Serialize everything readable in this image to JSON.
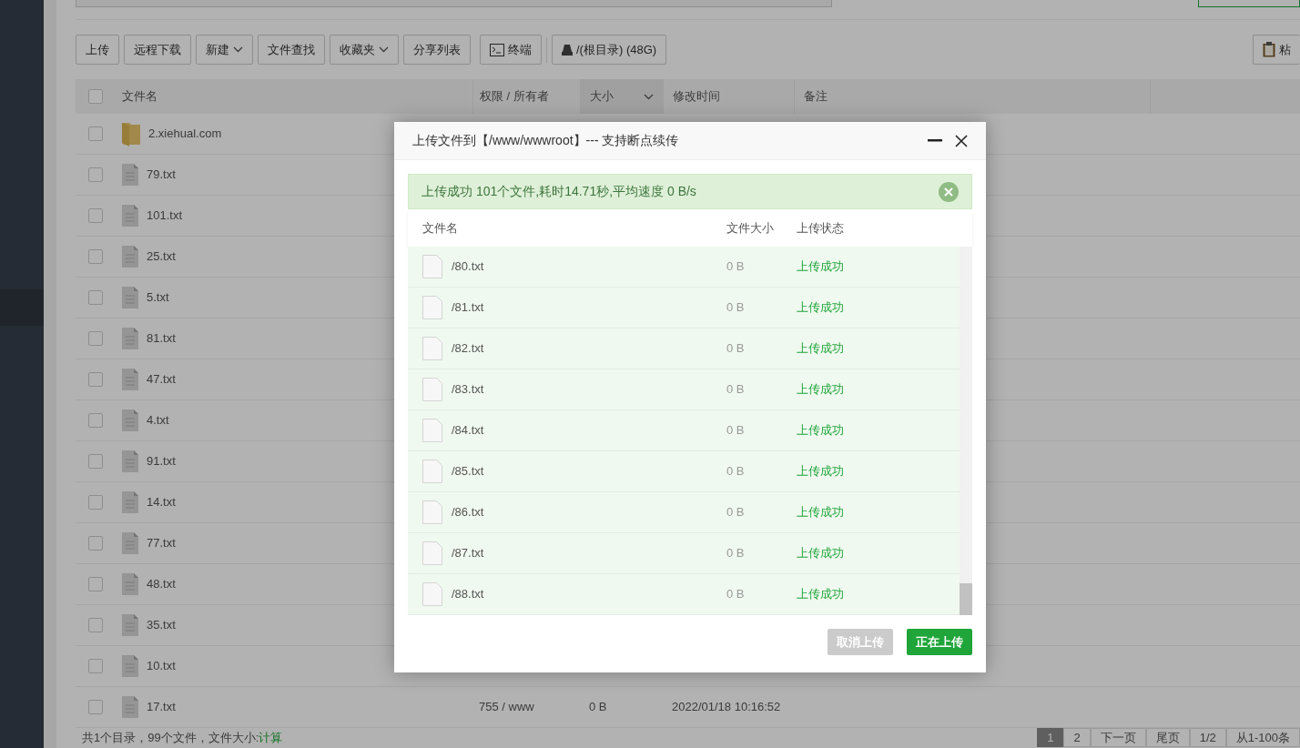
{
  "toolbar": {
    "buttons": [
      {
        "label": "上传",
        "kind": "plain"
      },
      {
        "label": "远程下载",
        "kind": "plain"
      },
      {
        "label": "新建",
        "kind": "dropdown"
      },
      {
        "label": "文件查找",
        "kind": "plain"
      },
      {
        "label": "收藏夹",
        "kind": "dropdown"
      },
      {
        "label": "分享列表",
        "kind": "plain"
      },
      {
        "label": "终端",
        "kind": "terminal"
      },
      {
        "label": "/(根目录) (48G)",
        "kind": "disk"
      }
    ],
    "paste_button": {
      "label": "粘"
    }
  },
  "file_table": {
    "all_checked": false,
    "columns": [
      {
        "label": "文件名",
        "sorted": false
      },
      {
        "label": "权限 / 所有者",
        "sorted": false
      },
      {
        "label": "大小",
        "sorted": true
      },
      {
        "label": "修改时间",
        "sorted": false
      },
      {
        "label": "备注",
        "sorted": false
      }
    ],
    "rows": [
      {
        "name": "2.xiehual.com",
        "kind": "folder",
        "checked": false
      },
      {
        "name": "79.txt",
        "kind": "file",
        "checked": false
      },
      {
        "name": "101.txt",
        "kind": "file",
        "checked": false
      },
      {
        "name": "25.txt",
        "kind": "file",
        "checked": false
      },
      {
        "name": "5.txt",
        "kind": "file",
        "checked": false
      },
      {
        "name": "81.txt",
        "kind": "file",
        "checked": false
      },
      {
        "name": "47.txt",
        "kind": "file",
        "checked": false
      },
      {
        "name": "4.txt",
        "kind": "file",
        "checked": false
      },
      {
        "name": "91.txt",
        "kind": "file",
        "checked": false
      },
      {
        "name": "14.txt",
        "kind": "file",
        "checked": false
      },
      {
        "name": "77.txt",
        "kind": "file",
        "checked": false
      },
      {
        "name": "48.txt",
        "kind": "file",
        "checked": false
      },
      {
        "name": "35.txt",
        "kind": "file",
        "checked": false
      },
      {
        "name": "10.txt",
        "kind": "file",
        "checked": false
      },
      {
        "name": "17.txt",
        "kind": "file",
        "checked": false,
        "permissions": "755 / www",
        "size": "0 B",
        "modified": "2022/01/18 10:16:52"
      }
    ]
  },
  "footer": {
    "summary": "共1个目录，99个文件，文件大小:",
    "calc_link": "计算",
    "pagination": [
      {
        "label": "1",
        "selected": true
      },
      {
        "label": "2",
        "selected": false
      },
      {
        "label": "下一页",
        "selected": false
      },
      {
        "label": "尾页",
        "selected": false
      },
      {
        "label": "1/2",
        "selected": false
      },
      {
        "label": "从1-100条",
        "selected": false
      }
    ]
  },
  "dialog": {
    "title": "上传文件到【/www/wwwroot】--- 支持断点续传",
    "alert": "上传成功 101个文件,耗时14.71秒,平均速度 0 B/s",
    "columns": [
      "文件名",
      "文件大小",
      "上传状态"
    ],
    "rows": [
      {
        "name": "/80.txt",
        "size": "0 B",
        "status": "上传成功"
      },
      {
        "name": "/81.txt",
        "size": "0 B",
        "status": "上传成功"
      },
      {
        "name": "/82.txt",
        "size": "0 B",
        "status": "上传成功"
      },
      {
        "name": "/83.txt",
        "size": "0 B",
        "status": "上传成功"
      },
      {
        "name": "/84.txt",
        "size": "0 B",
        "status": "上传成功"
      },
      {
        "name": "/85.txt",
        "size": "0 B",
        "status": "上传成功"
      },
      {
        "name": "/86.txt",
        "size": "0 B",
        "status": "上传成功"
      },
      {
        "name": "/87.txt",
        "size": "0 B",
        "status": "上传成功"
      },
      {
        "name": "/88.txt",
        "size": "0 B",
        "status": "上传成功"
      }
    ],
    "buttons": [
      {
        "label": "取消上传",
        "disabled": true
      },
      {
        "label": "正在上传",
        "disabled": false
      }
    ]
  }
}
